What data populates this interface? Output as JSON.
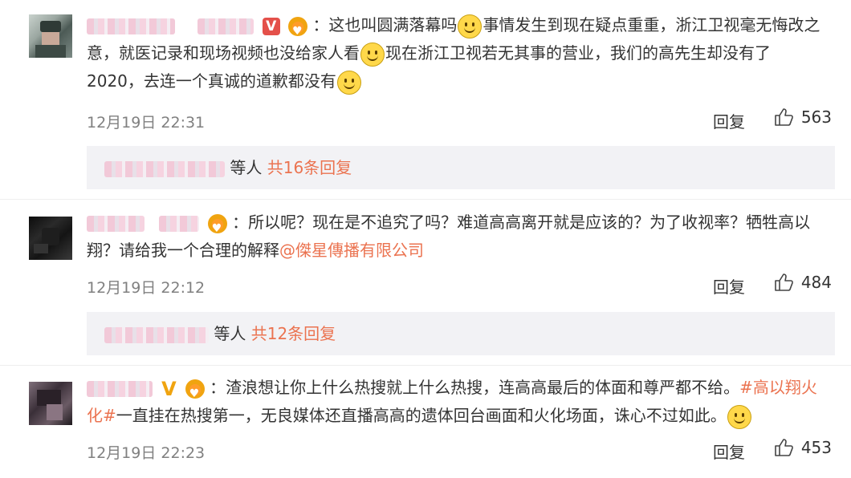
{
  "comments": [
    {
      "text_a": "：这也叫圆满落幕吗",
      "text_b": "事情发生到现在疑点重重，浙江卫视毫无悔改之意，就医记录和现场视频也没给家人看",
      "text_c": "现在浙江卫视若无其事的营业，我们的高先生却没有了2020，去连一个真诚的道歉都没有",
      "date": "12月19日 22:31",
      "reply_label": "回复",
      "likes": "563",
      "more": {
        "suffix": "等人",
        "count": "共16条回复"
      }
    },
    {
      "text_a": "：所以呢？现在是不追究了吗？难道高高离开就是应该的？为了收视率？牺牲高以翔？请给我一个合理的解释",
      "mention": "@傑星傳播有限公司",
      "date": "12月19日 22:12",
      "reply_label": "回复",
      "likes": "484",
      "more": {
        "suffix": "等人",
        "count": "共12条回复"
      }
    },
    {
      "text_a": "：渣浪想让你上什么热搜就上什么热搜，连高高最后的体面和尊严都不给。",
      "hashtag": "#高以翔火化#",
      "text_b": "一直挂在热搜第一，无良媒体还直播高高的遗体回台画面和火化场面，诛心不过如此。",
      "date": "12月19日 22:23",
      "reply_label": "回复",
      "likes": "453"
    }
  ],
  "icons": {
    "verified_red": "V",
    "verified_gold": "V",
    "medal": "fan-medal-icon",
    "emoji": "smile-emoji-icon",
    "like": "thumbs-up-icon"
  },
  "colors": {
    "link": "#eb7350",
    "meta": "#808080",
    "more_bg": "#f2f2f5",
    "verified_red": "#e4504a",
    "verified_gold": "#f0a410"
  }
}
